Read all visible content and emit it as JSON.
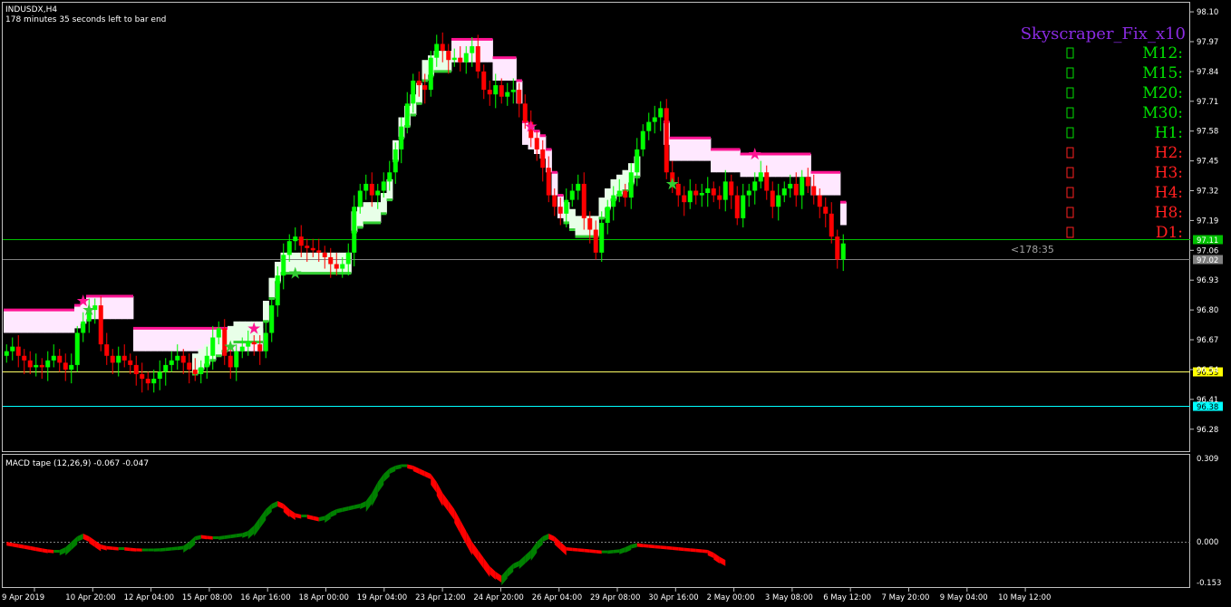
{
  "header": {
    "symbol": "INDUSDX,H4",
    "timer": "178 minutes 35 seconds left to bar end"
  },
  "macd": {
    "label": "MACD tape (12,26,9) -0.067 -0.047",
    "axis_ticks": [
      "0.309",
      "0.000",
      "-0.153"
    ]
  },
  "countdown": "<178:35",
  "colors": {
    "bull": "#00ff00",
    "bear": "#ff0000",
    "upper_band": "#ff1493",
    "lower_band": "#32cd32",
    "indicator_title": "#8a2be2"
  },
  "dashboard": {
    "title": "Skyscraper_Fix_x10",
    "rows": [
      {
        "tf": "M12:",
        "state": "up",
        "icon": "arrow-glyph-icon"
      },
      {
        "tf": "M15:",
        "state": "up",
        "icon": "arrow-glyph-icon"
      },
      {
        "tf": "M20:",
        "state": "up",
        "icon": "arrow-glyph-icon"
      },
      {
        "tf": "M30:",
        "state": "up",
        "icon": "arrow-glyph-icon"
      },
      {
        "tf": "H1:",
        "state": "up",
        "icon": "arrow-glyph-icon"
      },
      {
        "tf": "H2:",
        "state": "down",
        "icon": "arrow-glyph-icon"
      },
      {
        "tf": "H3:",
        "state": "down",
        "icon": "arrow-glyph-icon"
      },
      {
        "tf": "H4:",
        "state": "down",
        "icon": "arrow-glyph-icon"
      },
      {
        "tf": "H8:",
        "state": "down",
        "icon": "arrow-glyph-icon"
      },
      {
        "tf": "D1:",
        "state": "down",
        "icon": "arrow-glyph-icon"
      }
    ]
  },
  "chart_data": {
    "type": "candlestick",
    "symbol": "INDUSDX",
    "timeframe": "H4",
    "ylim": [
      96.2,
      98.12
    ],
    "y_ticks": [
      "98.10",
      "97.97",
      "97.84",
      "97.71",
      "97.58",
      "97.45",
      "97.32",
      "97.19",
      "97.06",
      "96.93",
      "96.80",
      "96.67",
      "96.54",
      "96.41",
      "96.28"
    ],
    "x_ticks": [
      "9 Apr 2019",
      "10 Apr 20:00",
      "12 Apr 04:00",
      "15 Apr 08:00",
      "16 Apr 16:00",
      "18 Apr 00:00",
      "19 Apr 04:00",
      "23 Apr 12:00",
      "24 Apr 20:00",
      "26 Apr 04:00",
      "29 Apr 08:00",
      "30 Apr 16:00",
      "2 May 00:00",
      "3 May 08:00",
      "6 May 12:00",
      "7 May 20:00",
      "9 May 04:00",
      "10 May 12:00"
    ],
    "price_levels": [
      {
        "value": 97.11,
        "label": "97.11",
        "line_color": "#00c000",
        "tag_bg": "#00c000",
        "tag_fg": "#ffffff"
      },
      {
        "value": 97.02,
        "label": "97.02",
        "line_color": "#808080",
        "tag_bg": "#808080",
        "tag_fg": "#ffffff"
      },
      {
        "value": 96.53,
        "label": "96.53",
        "line_color": "#ffff66",
        "tag_bg": "#ffff00",
        "tag_fg": "#000000"
      },
      {
        "value": 96.38,
        "label": "96.38",
        "line_color": "#00ffff",
        "tag_bg": "#00ffff",
        "tag_fg": "#000000"
      }
    ],
    "closes": [
      96.62,
      96.64,
      96.6,
      96.58,
      96.55,
      96.56,
      96.55,
      96.58,
      96.6,
      96.57,
      96.54,
      96.56,
      96.7,
      96.75,
      96.8,
      96.82,
      96.65,
      96.6,
      96.57,
      96.6,
      96.58,
      96.56,
      96.52,
      96.5,
      96.48,
      96.5,
      96.53,
      96.56,
      96.58,
      96.6,
      96.57,
      96.54,
      96.52,
      96.55,
      96.6,
      96.68,
      96.72,
      96.6,
      96.55,
      96.62,
      96.64,
      96.66,
      96.65,
      96.62,
      96.7,
      96.82,
      96.95,
      97.04,
      97.1,
      97.12,
      97.08,
      97.07,
      97.06,
      97.05,
      97.03,
      97.0,
      96.98,
      97.0,
      97.05,
      97.25,
      97.32,
      97.35,
      97.3,
      97.32,
      97.36,
      97.4,
      97.5,
      97.6,
      97.7,
      97.8,
      97.78,
      97.76,
      97.9,
      97.96,
      97.93,
      97.89,
      97.9,
      97.88,
      97.92,
      97.95,
      97.84,
      97.76,
      97.74,
      97.78,
      97.73,
      97.75,
      97.76,
      97.7,
      97.62,
      97.55,
      97.5,
      97.42,
      97.3,
      97.25,
      97.22,
      97.28,
      97.32,
      97.35,
      97.2,
      97.15,
      97.05,
      97.18,
      97.25,
      97.3,
      97.32,
      97.29,
      97.4,
      97.5,
      97.58,
      97.62,
      97.64,
      97.68,
      97.4,
      97.35,
      97.3,
      97.27,
      97.32,
      97.3,
      97.31,
      97.33,
      97.3,
      97.28,
      97.36,
      97.3,
      97.2,
      97.3,
      97.32,
      97.36,
      97.4,
      97.32,
      97.25,
      97.3,
      97.33,
      97.35,
      97.3,
      97.38,
      97.34,
      97.3,
      97.25,
      97.22,
      97.12,
      97.02,
      97.09
    ],
    "upper_band": [
      96.8,
      96.8,
      96.8,
      96.8,
      96.8,
      96.8,
      96.8,
      96.8,
      96.8,
      96.8,
      96.8,
      96.8,
      96.82,
      96.84,
      96.86,
      96.86,
      96.86,
      96.86,
      96.86,
      96.86,
      96.86,
      96.86,
      96.72,
      96.72,
      96.72,
      96.72,
      96.72,
      96.72,
      96.72,
      96.72,
      96.72,
      96.72,
      96.72,
      96.72,
      96.72,
      96.72,
      96.72,
      96.72,
      96.72,
      96.72,
      96.72,
      96.72,
      96.72,
      96.72,
      null,
      null,
      null,
      null,
      null,
      null,
      null,
      null,
      null,
      null,
      null,
      null,
      null,
      null,
      null,
      null,
      null,
      null,
      null,
      null,
      null,
      null,
      null,
      null,
      null,
      null,
      null,
      null,
      null,
      null,
      null,
      null,
      97.98,
      97.98,
      97.98,
      97.98,
      97.98,
      97.98,
      97.98,
      97.9,
      97.9,
      97.9,
      97.9,
      97.8,
      97.62,
      97.6,
      97.58,
      97.56,
      97.5,
      97.4,
      97.3,
      null,
      null,
      null,
      null,
      null,
      null,
      null,
      null,
      null,
      null,
      null,
      null,
      null,
      null,
      null,
      null,
      null,
      97.62,
      97.55,
      97.55,
      97.55,
      97.55,
      97.55,
      97.55,
      97.55,
      97.5,
      97.5,
      97.5,
      97.5,
      97.5,
      97.48,
      97.48,
      97.48,
      97.48,
      97.48,
      97.48,
      97.48,
      97.48,
      97.48,
      97.48,
      97.48,
      97.48,
      97.4,
      97.4,
      97.4,
      97.4,
      97.4,
      97.27,
      97.27,
      97.27
    ],
    "lower_band": [
      null,
      null,
      null,
      null,
      null,
      null,
      null,
      null,
      null,
      null,
      null,
      null,
      null,
      null,
      null,
      null,
      null,
      null,
      null,
      null,
      null,
      null,
      null,
      null,
      null,
      null,
      null,
      null,
      null,
      null,
      null,
      null,
      96.52,
      96.54,
      96.56,
      96.58,
      96.6,
      96.62,
      96.64,
      96.66,
      96.66,
      96.66,
      96.66,
      96.66,
      96.75,
      96.85,
      96.92,
      96.96,
      96.96,
      96.96,
      96.96,
      96.96,
      96.96,
      96.96,
      96.96,
      96.96,
      96.96,
      96.96,
      96.96,
      97.14,
      97.16,
      97.18,
      97.18,
      97.18,
      97.22,
      97.28,
      97.45,
      97.55,
      97.6,
      97.65,
      97.7,
      97.8,
      97.82,
      97.84,
      97.84,
      97.84,
      null,
      null,
      null,
      null,
      null,
      null,
      null,
      null,
      null,
      null,
      null,
      null,
      null,
      null,
      null,
      null,
      null,
      null,
      null,
      97.18,
      97.15,
      97.12,
      97.12,
      97.12,
      97.12,
      97.2,
      97.24,
      97.28,
      97.3,
      97.32,
      97.35,
      97.38,
      null,
      null,
      null,
      null,
      null,
      null,
      null,
      null,
      null,
      null,
      null,
      null,
      null,
      null,
      null,
      null,
      null,
      null,
      null,
      null,
      null,
      null,
      null,
      null,
      null,
      null,
      null,
      null,
      null,
      null,
      null
    ],
    "macd_hist": [
      0.0,
      -0.004,
      -0.008,
      -0.012,
      -0.016,
      -0.02,
      -0.024,
      -0.028,
      -0.03,
      -0.03,
      -0.02,
      0.0,
      0.02,
      0.03,
      0.02,
      0.005,
      -0.01,
      -0.016,
      -0.018,
      -0.02,
      -0.02,
      -0.022,
      -0.024,
      -0.025,
      -0.025,
      -0.025,
      -0.024,
      -0.022,
      -0.02,
      -0.018,
      -0.015,
      0.0,
      0.02,
      0.025,
      0.022,
      0.02,
      0.02,
      0.023,
      0.026,
      0.029,
      0.032,
      0.04,
      0.06,
      0.09,
      0.12,
      0.14,
      0.15,
      0.14,
      0.12,
      0.105,
      0.1,
      0.1,
      0.095,
      0.09,
      0.095,
      0.11,
      0.12,
      0.125,
      0.13,
      0.135,
      0.14,
      0.15,
      0.18,
      0.22,
      0.25,
      0.27,
      0.28,
      0.285,
      0.285,
      0.28,
      0.27,
      0.26,
      0.25,
      0.22,
      0.18,
      0.15,
      0.12,
      0.08,
      0.04,
      0.0,
      -0.03,
      -0.06,
      -0.09,
      -0.11,
      -0.125,
      -0.1,
      -0.08,
      -0.07,
      -0.05,
      -0.03,
      0.0,
      0.02,
      0.03,
      0.02,
      0.0,
      -0.02,
      -0.022,
      -0.024,
      -0.026,
      -0.028,
      -0.03,
      -0.032,
      -0.032,
      -0.03,
      -0.028,
      -0.02,
      -0.01,
      -0.005,
      -0.008,
      -0.01,
      -0.012,
      -0.014,
      -0.016,
      -0.018,
      -0.02,
      -0.022,
      -0.024,
      -0.026,
      -0.028,
      -0.03,
      -0.04,
      -0.055,
      -0.067
    ]
  }
}
